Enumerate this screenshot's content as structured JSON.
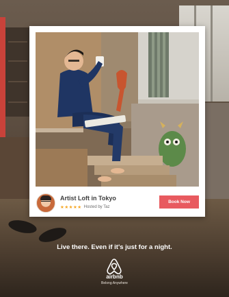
{
  "listing": {
    "title": "Artist Loft in Tokyo",
    "stars": "★★★★★",
    "host": "Hosted by Taz",
    "book_label": "Book Now"
  },
  "tagline": "Live there. Even if it's just for a night.",
  "brand": {
    "name": "airbnb",
    "slogan": "Belong Anywhere"
  },
  "colors": {
    "accent": "#e85a5f",
    "star": "#f5a623",
    "text_dark": "#3d3d3d"
  },
  "icons": [
    "airbnb-logo-icon",
    "host-avatar"
  ]
}
